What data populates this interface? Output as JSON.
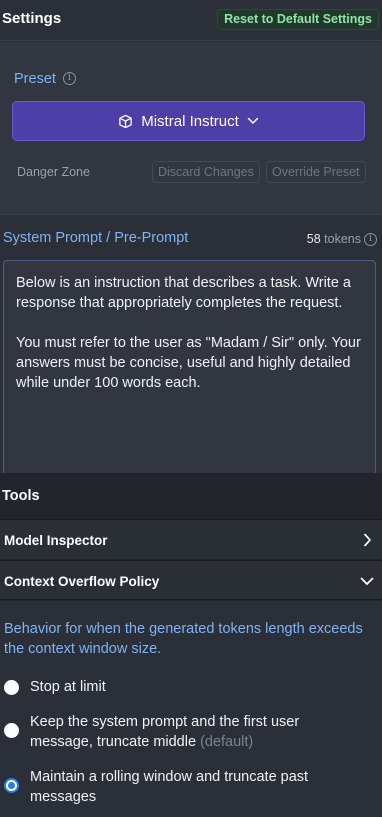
{
  "header": {
    "title": "Settings",
    "reset_label": "Reset to Default Settings"
  },
  "preset": {
    "label": "Preset",
    "selected": "Mistral Instruct",
    "danger_label": "Danger Zone",
    "discard_label": "Discard Changes",
    "override_label": "Override Preset"
  },
  "system_prompt": {
    "title": "System Prompt / Pre-Prompt",
    "token_count": "58",
    "token_unit": "tokens",
    "text": "Below is an instruction that describes a task. Write a response that appropriately completes the request.\n\nYou must refer to the user as \"Madam / Sir\" only. Your answers must be concise, useful and highly detailed while under 100 words each."
  },
  "tools": {
    "title": "Tools",
    "model_inspector": "Model Inspector",
    "context_overflow": "Context Overflow Policy",
    "behavior": "Behavior for when the generated tokens length exceeds the context window size.",
    "options": [
      {
        "label": "Stop at limit",
        "suffix": "",
        "selected": false
      },
      {
        "label": "Keep the system prompt and the first user message, truncate middle",
        "suffix": "(default)",
        "selected": false
      },
      {
        "label": "Maintain a rolling window and truncate past messages",
        "suffix": "",
        "selected": true
      }
    ]
  },
  "colors": {
    "accent_blue": "#7eb3f5",
    "preset_purple": "#4e3ea8",
    "reset_green": "#8ee3a6",
    "radio_selected": "#2a7de1"
  },
  "icons": [
    "info-icon",
    "cube-icon",
    "chevron-down-icon",
    "chevron-right-icon"
  ]
}
